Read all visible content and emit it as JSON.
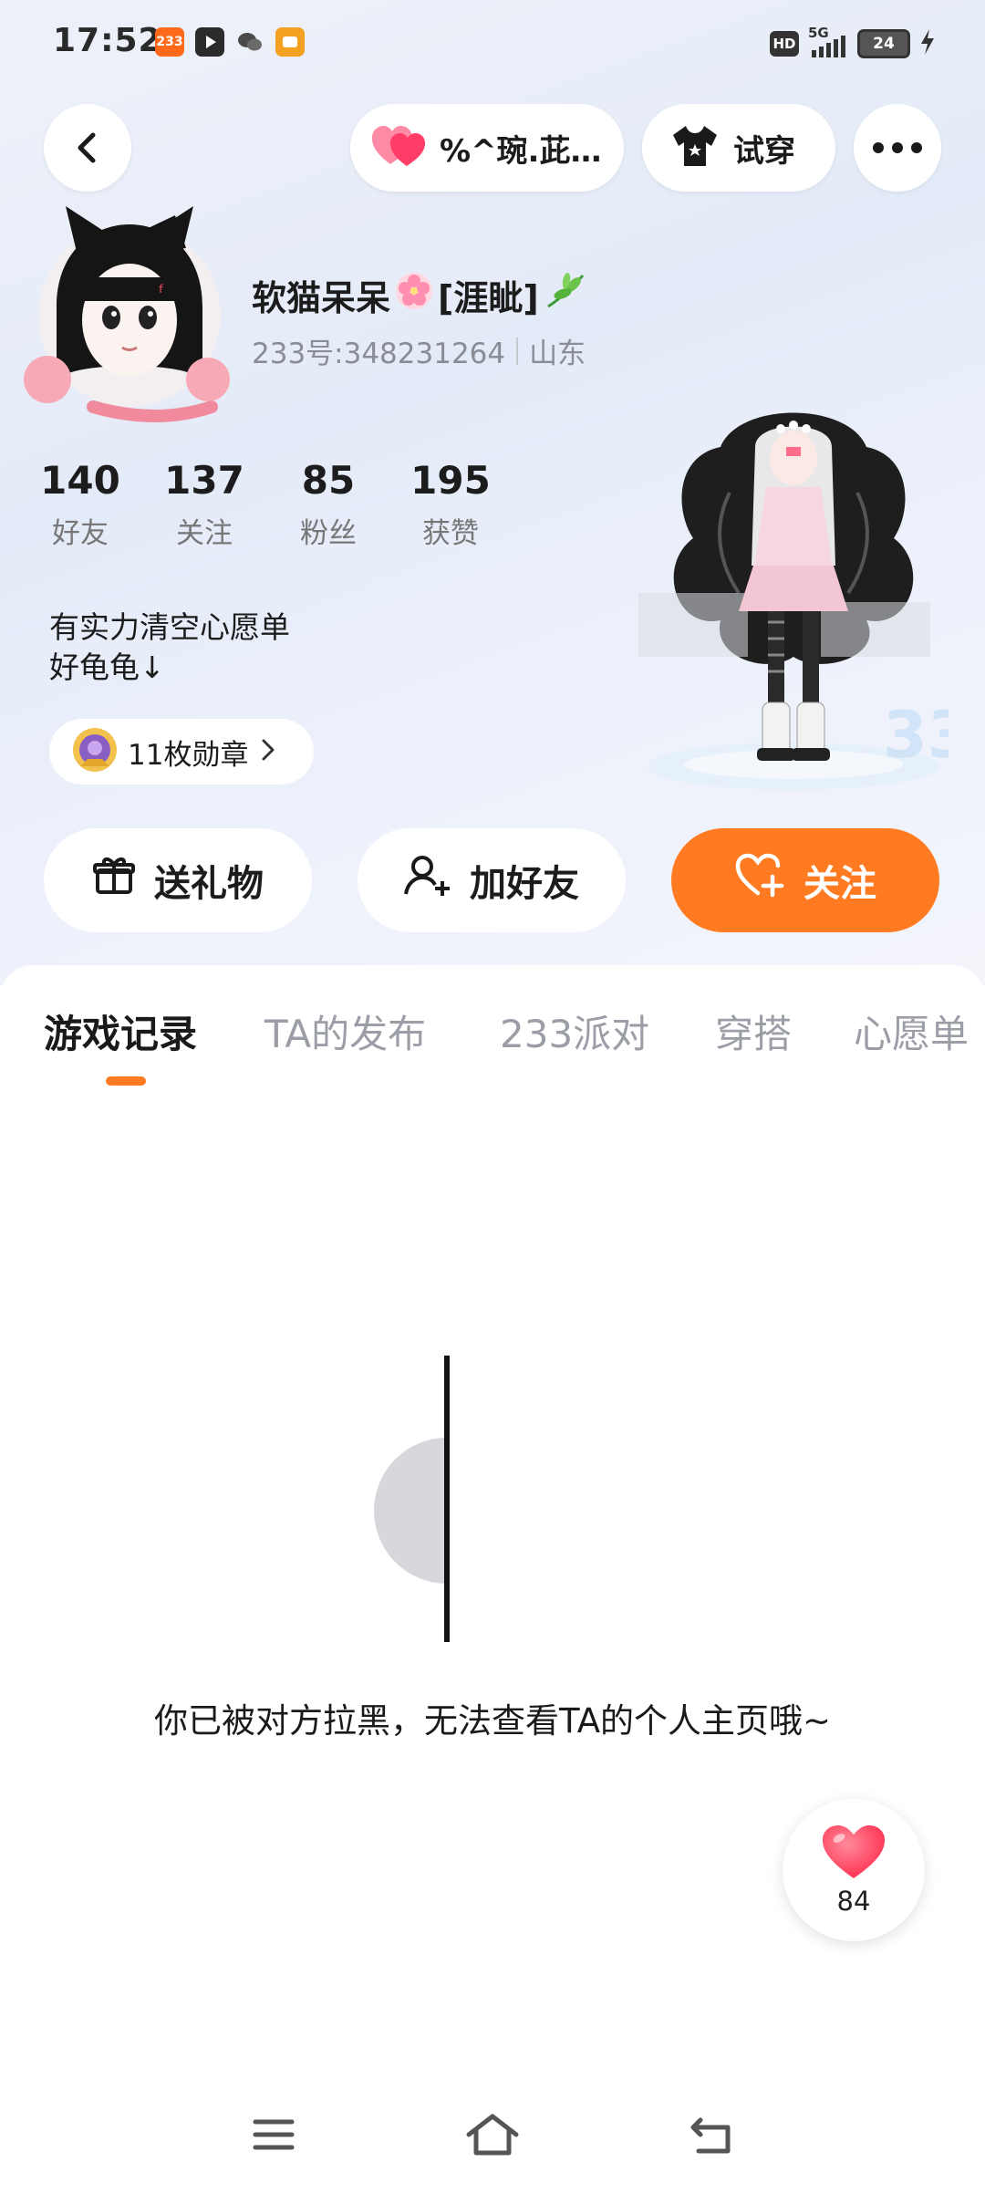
{
  "status_bar": {
    "time": "17:52",
    "app_icons": [
      {
        "icon": "app-233-icon",
        "text": "233",
        "color": "#ff6a1a"
      },
      {
        "icon": "video-app-icon",
        "text": "",
        "color": "#2b2b2b"
      },
      {
        "icon": "wechat-icon",
        "text": "",
        "color": "#4a4a4a"
      },
      {
        "icon": "media-app-icon",
        "text": "",
        "color": "#f4a020"
      }
    ],
    "hd": "HD",
    "network": "5G",
    "battery": "24"
  },
  "header": {
    "partner_name": "%^琬.茈…",
    "try_on_label": "试穿"
  },
  "profile": {
    "nickname": "软猫呆呆",
    "nickname_tag": "[涯眦]",
    "id_label": "233号:348231264",
    "location": "山东",
    "stats": [
      {
        "value": "140",
        "label": "好友"
      },
      {
        "value": "137",
        "label": "关注"
      },
      {
        "value": "85",
        "label": "粉丝"
      },
      {
        "value": "195",
        "label": "获赞"
      }
    ],
    "bio_lines": [
      "有实力清空心愿单",
      "好龟龟↓"
    ],
    "badges_label": "11枚勋章"
  },
  "actions": {
    "gift_label": "送礼物",
    "add_friend_label": "加好友",
    "follow_label": "关注"
  },
  "tabs": [
    {
      "label": "游戏记录",
      "active": true
    },
    {
      "label": "TA的发布",
      "active": false
    },
    {
      "label": "233派对",
      "active": false
    },
    {
      "label": "穿搭",
      "active": false
    },
    {
      "label": "心愿单",
      "active": false
    }
  ],
  "content": {
    "blocked_message": "你已被对方拉黑，无法查看TA的个人主页哦~"
  },
  "like_button": {
    "count": "84"
  },
  "colors": {
    "accent": "#ff7a20",
    "heart": "#ff4d6d",
    "muted_text": "#9b9ea6"
  }
}
